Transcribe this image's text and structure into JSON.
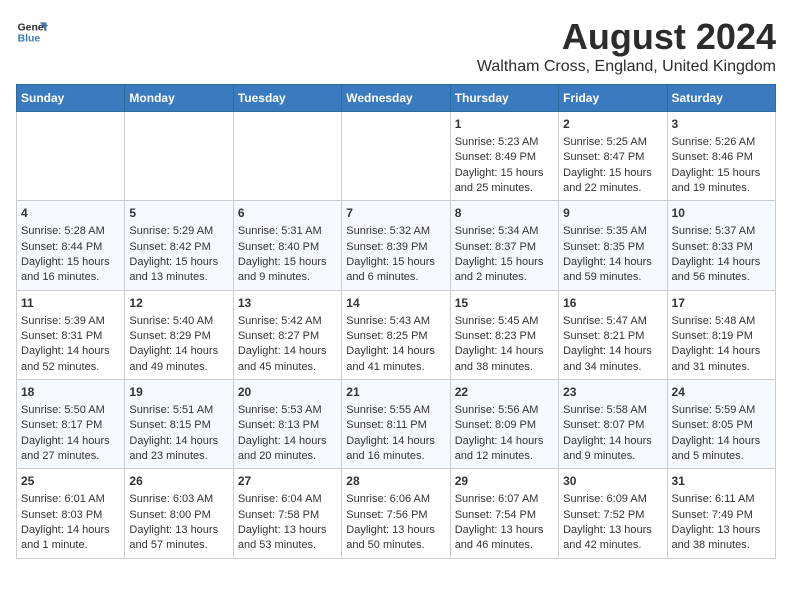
{
  "header": {
    "logo_line1": "General",
    "logo_line2": "Blue",
    "main_title": "August 2024",
    "subtitle": "Waltham Cross, England, United Kingdom"
  },
  "calendar": {
    "days_of_week": [
      "Sunday",
      "Monday",
      "Tuesday",
      "Wednesday",
      "Thursday",
      "Friday",
      "Saturday"
    ],
    "weeks": [
      [
        {
          "day": "",
          "content": ""
        },
        {
          "day": "",
          "content": ""
        },
        {
          "day": "",
          "content": ""
        },
        {
          "day": "",
          "content": ""
        },
        {
          "day": "1",
          "content": "Sunrise: 5:23 AM\nSunset: 8:49 PM\nDaylight: 15 hours\nand 25 minutes."
        },
        {
          "day": "2",
          "content": "Sunrise: 5:25 AM\nSunset: 8:47 PM\nDaylight: 15 hours\nand 22 minutes."
        },
        {
          "day": "3",
          "content": "Sunrise: 5:26 AM\nSunset: 8:46 PM\nDaylight: 15 hours\nand 19 minutes."
        }
      ],
      [
        {
          "day": "4",
          "content": "Sunrise: 5:28 AM\nSunset: 8:44 PM\nDaylight: 15 hours\nand 16 minutes."
        },
        {
          "day": "5",
          "content": "Sunrise: 5:29 AM\nSunset: 8:42 PM\nDaylight: 15 hours\nand 13 minutes."
        },
        {
          "day": "6",
          "content": "Sunrise: 5:31 AM\nSunset: 8:40 PM\nDaylight: 15 hours\nand 9 minutes."
        },
        {
          "day": "7",
          "content": "Sunrise: 5:32 AM\nSunset: 8:39 PM\nDaylight: 15 hours\nand 6 minutes."
        },
        {
          "day": "8",
          "content": "Sunrise: 5:34 AM\nSunset: 8:37 PM\nDaylight: 15 hours\nand 2 minutes."
        },
        {
          "day": "9",
          "content": "Sunrise: 5:35 AM\nSunset: 8:35 PM\nDaylight: 14 hours\nand 59 minutes."
        },
        {
          "day": "10",
          "content": "Sunrise: 5:37 AM\nSunset: 8:33 PM\nDaylight: 14 hours\nand 56 minutes."
        }
      ],
      [
        {
          "day": "11",
          "content": "Sunrise: 5:39 AM\nSunset: 8:31 PM\nDaylight: 14 hours\nand 52 minutes."
        },
        {
          "day": "12",
          "content": "Sunrise: 5:40 AM\nSunset: 8:29 PM\nDaylight: 14 hours\nand 49 minutes."
        },
        {
          "day": "13",
          "content": "Sunrise: 5:42 AM\nSunset: 8:27 PM\nDaylight: 14 hours\nand 45 minutes."
        },
        {
          "day": "14",
          "content": "Sunrise: 5:43 AM\nSunset: 8:25 PM\nDaylight: 14 hours\nand 41 minutes."
        },
        {
          "day": "15",
          "content": "Sunrise: 5:45 AM\nSunset: 8:23 PM\nDaylight: 14 hours\nand 38 minutes."
        },
        {
          "day": "16",
          "content": "Sunrise: 5:47 AM\nSunset: 8:21 PM\nDaylight: 14 hours\nand 34 minutes."
        },
        {
          "day": "17",
          "content": "Sunrise: 5:48 AM\nSunset: 8:19 PM\nDaylight: 14 hours\nand 31 minutes."
        }
      ],
      [
        {
          "day": "18",
          "content": "Sunrise: 5:50 AM\nSunset: 8:17 PM\nDaylight: 14 hours\nand 27 minutes."
        },
        {
          "day": "19",
          "content": "Sunrise: 5:51 AM\nSunset: 8:15 PM\nDaylight: 14 hours\nand 23 minutes."
        },
        {
          "day": "20",
          "content": "Sunrise: 5:53 AM\nSunset: 8:13 PM\nDaylight: 14 hours\nand 20 minutes."
        },
        {
          "day": "21",
          "content": "Sunrise: 5:55 AM\nSunset: 8:11 PM\nDaylight: 14 hours\nand 16 minutes."
        },
        {
          "day": "22",
          "content": "Sunrise: 5:56 AM\nSunset: 8:09 PM\nDaylight: 14 hours\nand 12 minutes."
        },
        {
          "day": "23",
          "content": "Sunrise: 5:58 AM\nSunset: 8:07 PM\nDaylight: 14 hours\nand 9 minutes."
        },
        {
          "day": "24",
          "content": "Sunrise: 5:59 AM\nSunset: 8:05 PM\nDaylight: 14 hours\nand 5 minutes."
        }
      ],
      [
        {
          "day": "25",
          "content": "Sunrise: 6:01 AM\nSunset: 8:03 PM\nDaylight: 14 hours\nand 1 minute."
        },
        {
          "day": "26",
          "content": "Sunrise: 6:03 AM\nSunset: 8:00 PM\nDaylight: 13 hours\nand 57 minutes."
        },
        {
          "day": "27",
          "content": "Sunrise: 6:04 AM\nSunset: 7:58 PM\nDaylight: 13 hours\nand 53 minutes."
        },
        {
          "day": "28",
          "content": "Sunrise: 6:06 AM\nSunset: 7:56 PM\nDaylight: 13 hours\nand 50 minutes."
        },
        {
          "day": "29",
          "content": "Sunrise: 6:07 AM\nSunset: 7:54 PM\nDaylight: 13 hours\nand 46 minutes."
        },
        {
          "day": "30",
          "content": "Sunrise: 6:09 AM\nSunset: 7:52 PM\nDaylight: 13 hours\nand 42 minutes."
        },
        {
          "day": "31",
          "content": "Sunrise: 6:11 AM\nSunset: 7:49 PM\nDaylight: 13 hours\nand 38 minutes."
        }
      ]
    ]
  }
}
